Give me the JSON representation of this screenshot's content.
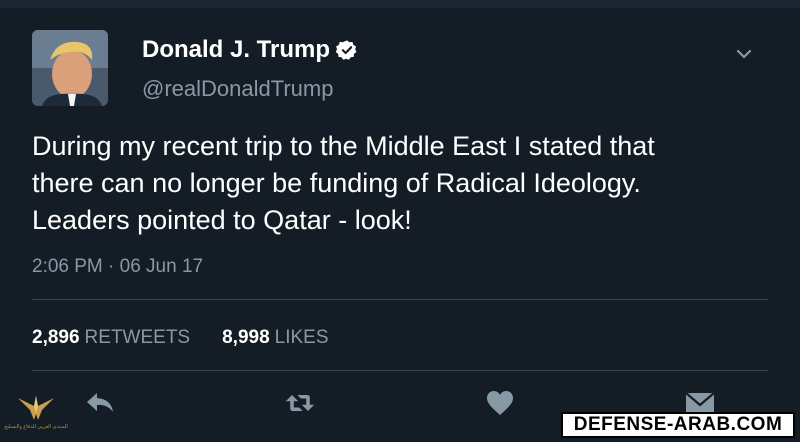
{
  "author": {
    "name": "Donald J. Trump",
    "handle": "@realDonaldTrump",
    "verified": true
  },
  "tweet": {
    "text": "During my recent trip to the Middle East I stated that\nthere can no longer be funding of Radical Ideology.\nLeaders pointed to Qatar - look!",
    "timestamp": "2:06 PM · 06 Jun 17"
  },
  "stats": {
    "retweets_count": "2,896",
    "retweets_label": "RETWEETS",
    "likes_count": "8,998",
    "likes_label": "LIKES"
  },
  "actions": {
    "reply_icon": "reply-icon",
    "retweet_icon": "retweet-icon",
    "like_icon": "heart-icon",
    "dm_icon": "envelope-icon"
  },
  "watermark": {
    "text": "DEFENSE-ARAB.COM",
    "logo_text": "المنتدى العربي للدفاع والتسليح"
  },
  "colors": {
    "background": "#141d26",
    "text_primary": "#ffffff",
    "text_secondary": "#8899a6",
    "divider": "#38444d",
    "icon": "#8899a6"
  }
}
